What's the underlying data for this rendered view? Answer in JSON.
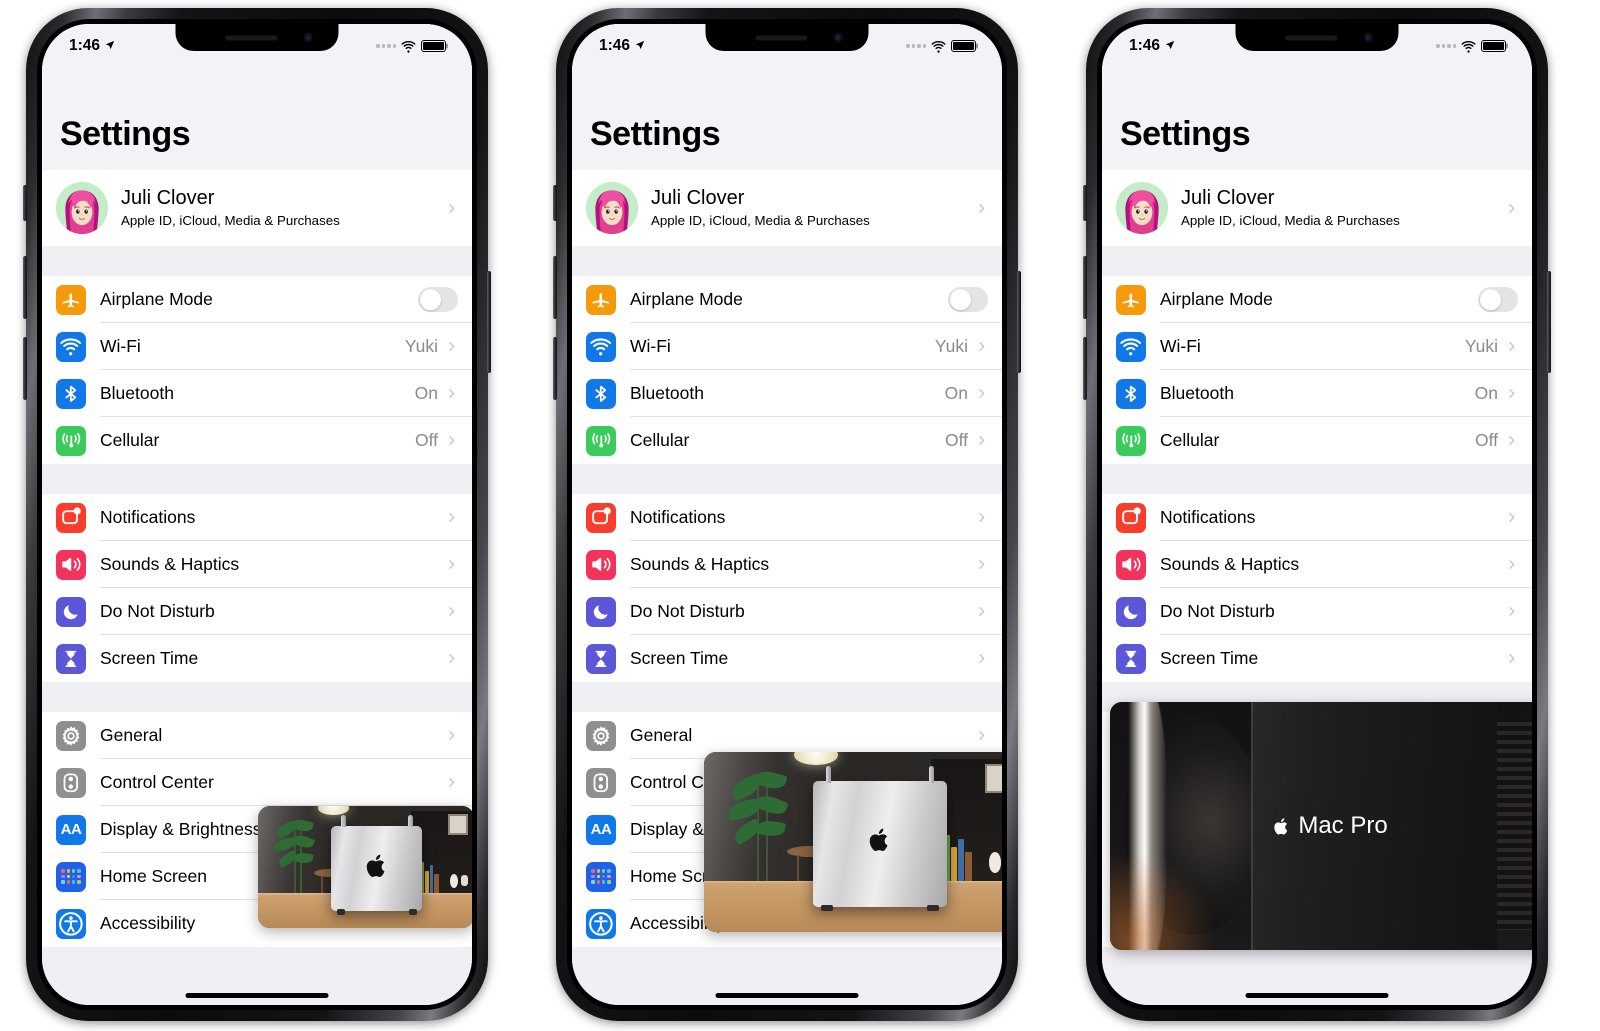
{
  "page": {
    "background": "#ffffff",
    "phone_count": 3
  },
  "status_bar": {
    "time": "1:46",
    "location_icon": "location-arrow-icon",
    "signal_icon": "cellular-dots-icon",
    "wifi_icon": "wifi-icon",
    "battery_icon": "battery-full-icon"
  },
  "screen": {
    "title": "Settings",
    "account": {
      "name": "Juli Clover",
      "subtitle": "Apple ID, iCloud, Media & Purchases",
      "avatar": "memoji-avatar",
      "avatar_bg": "#c2edc6",
      "chevron": "chevron-right-icon"
    },
    "groups": [
      {
        "id": "connectivity",
        "rows": [
          {
            "label": "Airplane Mode",
            "icon": "airplane-icon",
            "icon_color": "#f59a0b",
            "control": "toggle",
            "toggle_on": false
          },
          {
            "label": "Wi-Fi",
            "icon": "wifi-icon",
            "icon_color": "#1178e8",
            "value": "Yuki",
            "control": "chevron"
          },
          {
            "label": "Bluetooth",
            "icon": "bluetooth-icon",
            "icon_color": "#1178e8",
            "value": "On",
            "control": "chevron"
          },
          {
            "label": "Cellular",
            "icon": "cellular-antenna-icon",
            "icon_color": "#3bcb5a",
            "value": "Off",
            "control": "chevron"
          }
        ]
      },
      {
        "id": "alerts",
        "rows": [
          {
            "label": "Notifications",
            "icon": "notifications-icon",
            "icon_color": "#fa3c2d",
            "value": "",
            "control": "chevron"
          },
          {
            "label": "Sounds & Haptics",
            "icon": "sounds-haptics-icon",
            "icon_color": "#f4335c",
            "value": "",
            "control": "chevron"
          },
          {
            "label": "Do Not Disturb",
            "icon": "do-not-disturb-moon-icon",
            "icon_color": "#5c57d8",
            "value": "",
            "control": "chevron"
          },
          {
            "label": "Screen Time",
            "icon": "screen-time-hourglass-icon",
            "icon_color": "#5c57d8",
            "value": "",
            "control": "chevron"
          }
        ]
      },
      {
        "id": "system",
        "rows": [
          {
            "label": "General",
            "icon": "gear-icon",
            "icon_color": "#8e8e93",
            "value": "",
            "control": "chevron"
          },
          {
            "label": "Control Center",
            "icon": "control-center-icon",
            "icon_color": "#8e8e93",
            "value": "",
            "control": "chevron"
          },
          {
            "label": "Display & Brightness",
            "icon": "display-brightness-aa-icon",
            "icon_color": "#1178e8",
            "value": "",
            "control": "chevron"
          },
          {
            "label": "Home Screen",
            "icon": "home-screen-grid-icon",
            "icon_color": "#1d62e8",
            "value": "",
            "control": "chevron"
          },
          {
            "label": "Accessibility",
            "icon": "accessibility-icon",
            "icon_color": "#1178e8",
            "value": "",
            "control": "chevron"
          }
        ]
      }
    ]
  },
  "pip": {
    "phone1": {
      "caption": "",
      "scene": "mac-pro-desk-wide",
      "size": "small"
    },
    "phone2": {
      "caption": "",
      "scene": "mac-pro-desk-wide",
      "size": "medium"
    },
    "phone3": {
      "caption": "Mac Pro",
      "scene": "mac-pro-closeup",
      "size": "large"
    }
  },
  "colors": {
    "list_background": "#ffffff",
    "group_band": "#efeff4",
    "separator": "#e3e3e6",
    "secondary_text": "#8a8a8e",
    "chevron": "#c3c3c7",
    "toggle_off_track": "#e4e4e6"
  }
}
